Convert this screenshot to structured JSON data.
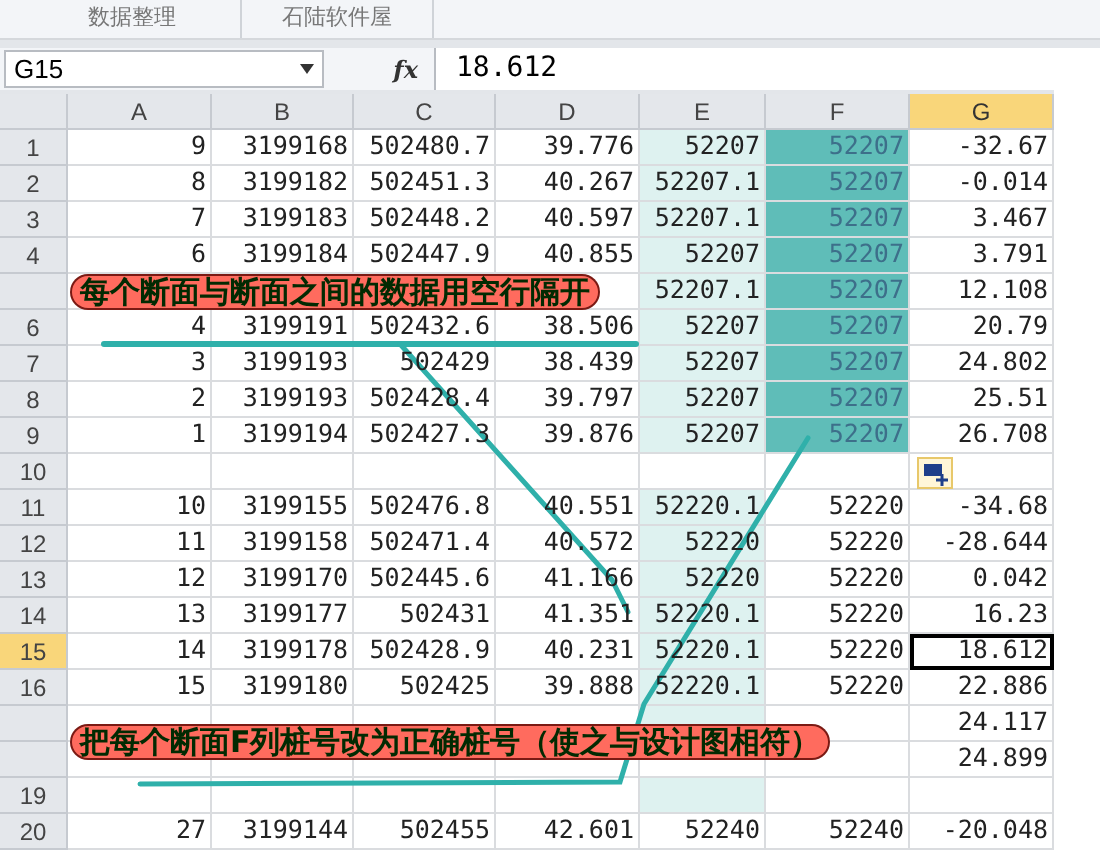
{
  "ribbon": {
    "groups": [
      "数据整理",
      "石陆软件屋"
    ]
  },
  "formula_bar": {
    "name_box": "G15",
    "function_label": "fx",
    "value": "18.612"
  },
  "columns": [
    {
      "label": "A",
      "selected": false
    },
    {
      "label": "B",
      "selected": false
    },
    {
      "label": "C",
      "selected": false
    },
    {
      "label": "D",
      "selected": false
    },
    {
      "label": "E",
      "selected": false
    },
    {
      "label": "F",
      "selected": false
    },
    {
      "label": "G",
      "selected": true
    }
  ],
  "rows": [
    {
      "header": "1",
      "selected": false,
      "e_highlight": true,
      "f_highlight": true,
      "cells": [
        "9",
        "3199168",
        "502480.7",
        "39.776",
        "52207",
        "52207",
        "-32.67"
      ]
    },
    {
      "header": "2",
      "selected": false,
      "e_highlight": true,
      "f_highlight": true,
      "cells": [
        "8",
        "3199182",
        "502451.3",
        "40.267",
        "52207.1",
        "52207",
        "-0.014"
      ]
    },
    {
      "header": "3",
      "selected": false,
      "e_highlight": true,
      "f_highlight": true,
      "cells": [
        "7",
        "3199183",
        "502448.2",
        "40.597",
        "52207.1",
        "52207",
        "3.467"
      ]
    },
    {
      "header": "4",
      "selected": false,
      "e_highlight": true,
      "f_highlight": true,
      "cells": [
        "6",
        "3199184",
        "502447.9",
        "40.855",
        "52207",
        "52207",
        "3.791"
      ]
    },
    {
      "selected": false,
      "e_highlight": true,
      "f_highlight": true,
      "cells": [
        null,
        null,
        null,
        null,
        "52207.1",
        "52207",
        "12.108"
      ]
    },
    {
      "header": "6",
      "selected": false,
      "e_highlight": true,
      "f_highlight": true,
      "cells": [
        "4",
        "3199191",
        "502432.6",
        "38.506",
        "52207",
        "52207",
        "20.79"
      ]
    },
    {
      "header": "7",
      "selected": false,
      "e_highlight": true,
      "f_highlight": true,
      "cells": [
        "3",
        "3199193",
        "502429",
        "38.439",
        "52207",
        "52207",
        "24.802"
      ]
    },
    {
      "header": "8",
      "selected": false,
      "e_highlight": true,
      "f_highlight": true,
      "cells": [
        "2",
        "3199193",
        "502428.4",
        "39.797",
        "52207",
        "52207",
        "25.51"
      ]
    },
    {
      "header": "9",
      "selected": false,
      "e_highlight": true,
      "f_highlight": true,
      "cells": [
        "1",
        "3199194",
        "502427.3",
        "39.876",
        "52207",
        "52207",
        "26.708"
      ]
    },
    {
      "header": "10",
      "selected": false,
      "e_highlight": false,
      "f_highlight": false,
      "cells": [
        null,
        null,
        null,
        null,
        null,
        null,
        null
      ]
    },
    {
      "header": "11",
      "selected": false,
      "e_highlight": true,
      "f_highlight": false,
      "cells": [
        "10",
        "3199155",
        "502476.8",
        "40.551",
        "52220.1",
        "52220",
        "-34.68"
      ]
    },
    {
      "header": "12",
      "selected": false,
      "e_highlight": true,
      "f_highlight": false,
      "cells": [
        "11",
        "3199158",
        "502471.4",
        "40.572",
        "52220",
        "52220",
        "-28.644"
      ]
    },
    {
      "header": "13",
      "selected": false,
      "e_highlight": true,
      "f_highlight": false,
      "cells": [
        "12",
        "3199170",
        "502445.6",
        "41.166",
        "52220",
        "52220",
        "0.042"
      ]
    },
    {
      "header": "14",
      "selected": false,
      "e_highlight": true,
      "f_highlight": false,
      "cells": [
        "13",
        "3199177",
        "502431",
        "41.351",
        "52220.1",
        "52220",
        "16.23"
      ]
    },
    {
      "header": "15",
      "selected": true,
      "e_highlight": true,
      "f_highlight": false,
      "cells": [
        "14",
        "3199178",
        "502428.9",
        "40.231",
        "52220.1",
        "52220",
        "18.612"
      ]
    },
    {
      "header": "16",
      "selected": false,
      "e_highlight": true,
      "f_highlight": false,
      "cells": [
        "15",
        "3199180",
        "502425",
        "39.888",
        "52220.1",
        "52220",
        "22.886"
      ]
    },
    {
      "selected": false,
      "e_highlight": true,
      "f_highlight": false,
      "cells": [
        null,
        null,
        null,
        null,
        null,
        null,
        "24.117"
      ]
    },
    {
      "selected": false,
      "f_highlight": false,
      "cells": [
        null,
        null,
        null,
        null,
        null,
        null,
        "24.899"
      ]
    },
    {
      "header": "19",
      "selected": false,
      "e_highlight": true,
      "f_highlight": false,
      "cells": [
        null,
        null,
        null,
        null,
        null,
        null,
        null
      ]
    },
    {
      "header": "20",
      "selected": false,
      "e_highlight": false,
      "f_highlight": false,
      "cells": [
        "27",
        "3199144",
        "502455",
        "42.601",
        "52240",
        "52240",
        "-20.048"
      ]
    }
  ],
  "annotations": [
    "每个断面与断面之间的数据用空行隔开",
    "把每个断面F列桩号改为正确桩号（使之与设计图相符）"
  ]
}
